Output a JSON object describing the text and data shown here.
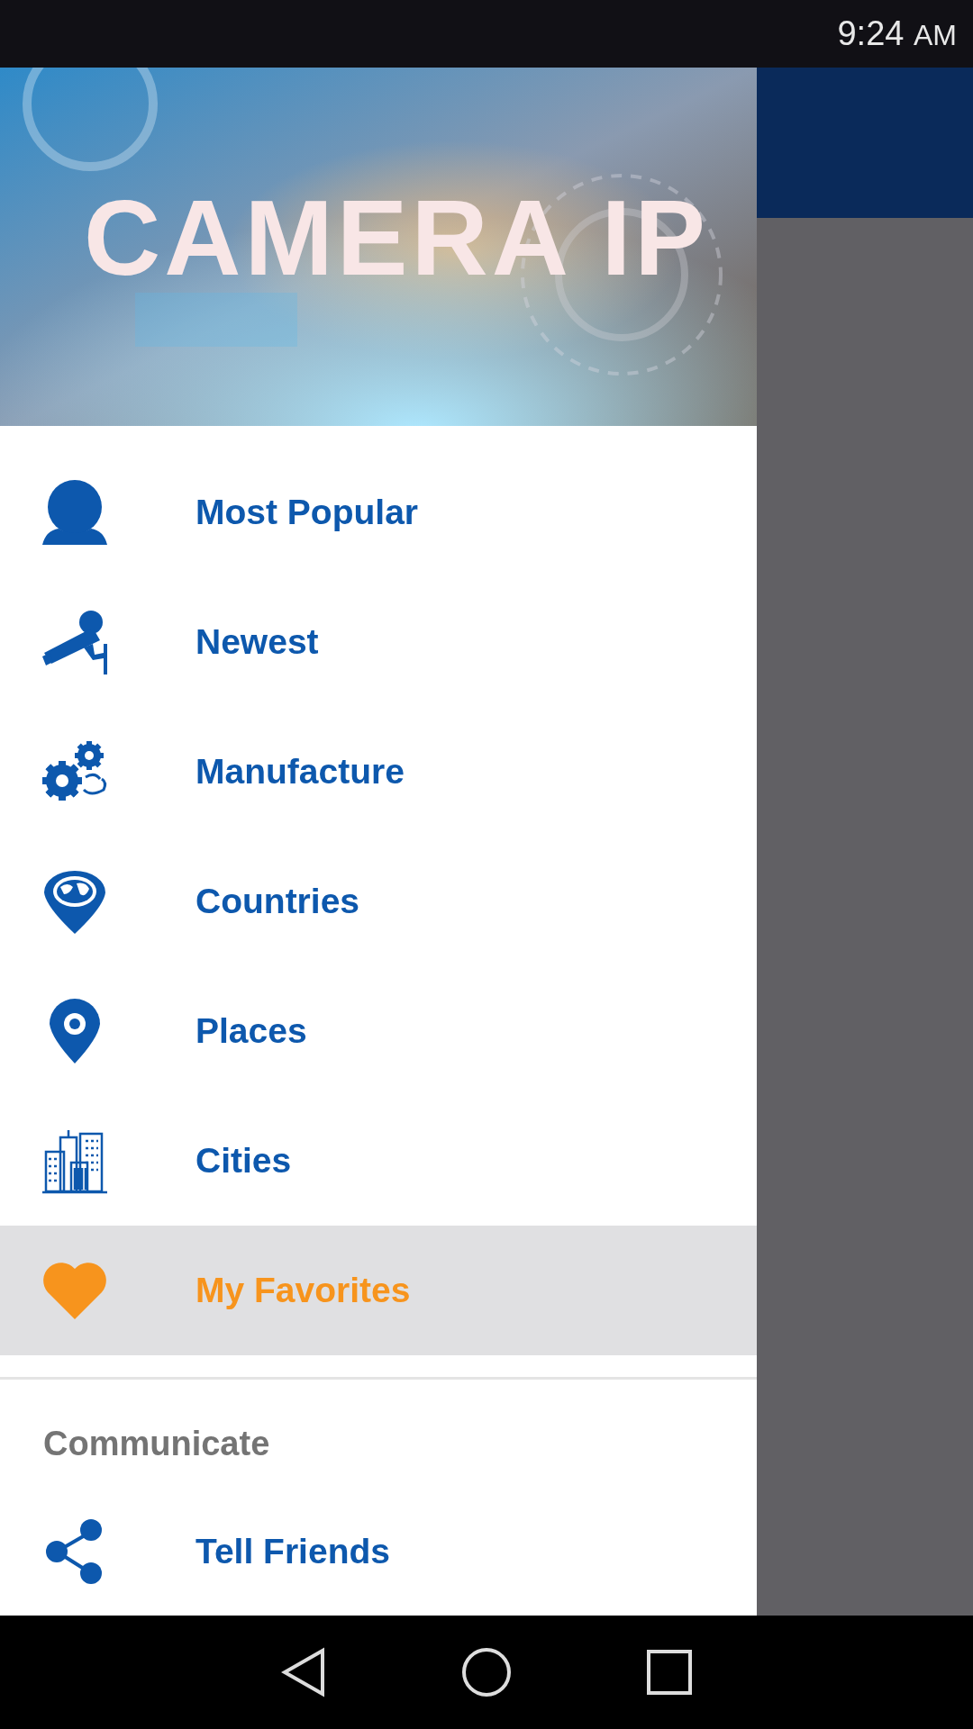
{
  "status_bar": {
    "time": "9:24",
    "period": "AM"
  },
  "header": {
    "title": "CAMERA IP"
  },
  "menu": {
    "items": [
      {
        "label": "Most Popular",
        "kind": "webcam",
        "selected": false
      },
      {
        "label": "Newest",
        "kind": "camera",
        "selected": false
      },
      {
        "label": "Manufacture",
        "kind": "gears",
        "selected": false
      },
      {
        "label": "Countries",
        "kind": "globe",
        "selected": false
      },
      {
        "label": "Places",
        "kind": "pin",
        "selected": false
      },
      {
        "label": "Cities",
        "kind": "city",
        "selected": false
      },
      {
        "label": "My Favorites",
        "kind": "heart",
        "selected": true
      }
    ]
  },
  "communicate": {
    "title": "Communicate",
    "items": [
      {
        "label": "Tell Friends",
        "kind": "share"
      }
    ]
  }
}
